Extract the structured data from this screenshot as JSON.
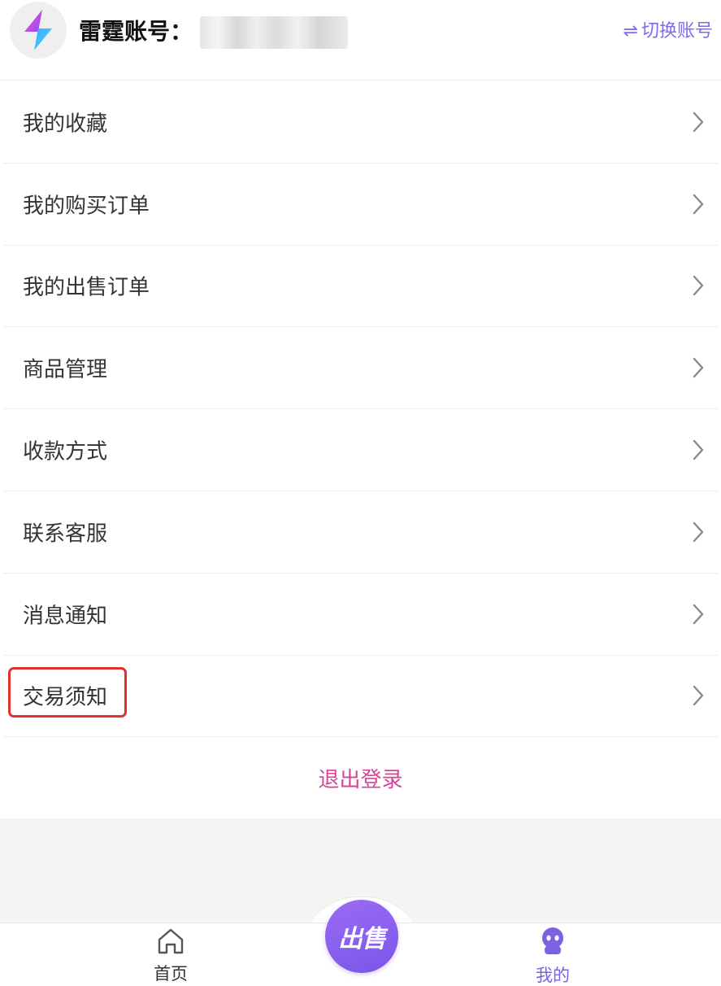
{
  "header": {
    "account_label": "雷霆账号：",
    "account_value": "",
    "switch_account_label": "切换账号",
    "switch_icon": "⇌"
  },
  "menu": {
    "items": [
      {
        "label": "我的收藏"
      },
      {
        "label": "我的购买订单"
      },
      {
        "label": "我的出售订单"
      },
      {
        "label": "商品管理"
      },
      {
        "label": "收款方式"
      },
      {
        "label": "联系客服"
      },
      {
        "label": "消息通知"
      },
      {
        "label": "交易须知"
      }
    ]
  },
  "logout_label": "退出登录",
  "tabbar": {
    "home_label": "首页",
    "sell_label": "出售",
    "mine_label": "我的"
  },
  "colors": {
    "accent": "#7b6cf0",
    "logout": "#d9439a",
    "highlight": "#e2312b",
    "sell_gradient_start": "#9b6cf4",
    "sell_gradient_end": "#7b55e8"
  },
  "icons": {
    "avatar": "lightning-logo-icon",
    "switch": "swap-arrows-icon",
    "chevron": "chevron-right-icon",
    "home": "home-outline-icon",
    "mine": "user-ghost-icon"
  }
}
